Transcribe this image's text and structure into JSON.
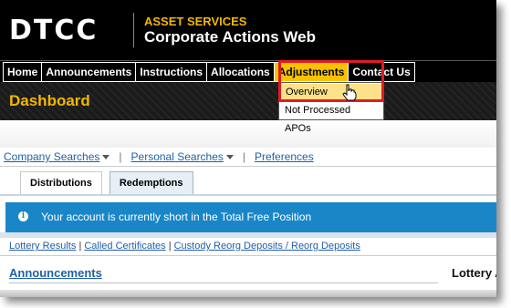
{
  "brand": {
    "logo": "DTCC",
    "product_line": "ASSET SERVICES",
    "product_name": "Corporate Actions Web"
  },
  "nav": {
    "items": [
      "Home",
      "Announcements",
      "Instructions",
      "Allocations",
      "Adjustments",
      "Contact Us"
    ],
    "active": "Adjustments"
  },
  "dropdown": {
    "items": [
      "Overview",
      "Not Processed APOs"
    ],
    "hovered": "Overview"
  },
  "dashboard": {
    "title": "Dashboard"
  },
  "subnav": {
    "company_searches": "Company Searches",
    "personal_searches": "Personal Searches",
    "preferences": "Preferences",
    "separator": "|"
  },
  "tabs": {
    "items": [
      "Distributions",
      "Redemptions"
    ],
    "selected": "Redemptions"
  },
  "info": {
    "message": "Your account is currently short in the Total Free Position"
  },
  "links": {
    "items": [
      "Lottery Results",
      "Called Certificates",
      "Custody Reorg Deposits / Reorg Deposits"
    ],
    "separator": "|"
  },
  "announcements": {
    "title": "Announcements",
    "right_label": "Lottery A"
  },
  "colors": {
    "brand_yellow": "#f2b705",
    "active_tab_yellow": "#f7c200",
    "highlight_red": "#e01b24",
    "info_blue": "#1a86c8",
    "link_blue": "#1f5fa8"
  }
}
